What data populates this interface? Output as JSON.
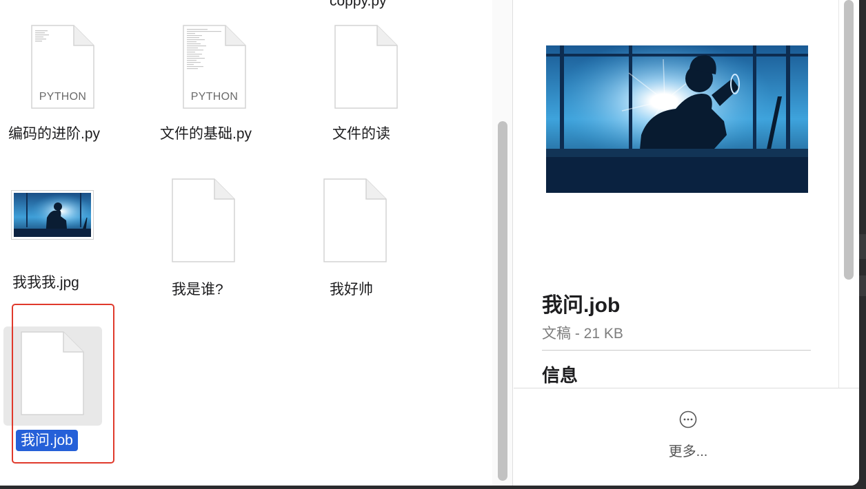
{
  "files": {
    "top_partial": "coppy.py",
    "row1": [
      {
        "name": "编码的进阶.py",
        "kind": "PYTHON"
      },
      {
        "name": "文件的基础.py",
        "kind": "PYTHON"
      },
      {
        "name": "文件的读",
        "kind": ""
      }
    ],
    "row2": [
      {
        "name": "我我我.jpg"
      },
      {
        "name": "我是谁?"
      },
      {
        "name": "我好帅"
      }
    ],
    "selected": {
      "name": "我问.job"
    }
  },
  "preview": {
    "title": "我问.job",
    "meta": "文稿 - 21 KB",
    "section": "信息",
    "more_label": "更多..."
  },
  "colors": {
    "selection_blue": "#2560d8",
    "highlight_red": "#e0392b"
  },
  "icons": {
    "document": "blank-document-icon",
    "image": "image-thumbnail",
    "more": "ellipsis-circle-icon"
  }
}
